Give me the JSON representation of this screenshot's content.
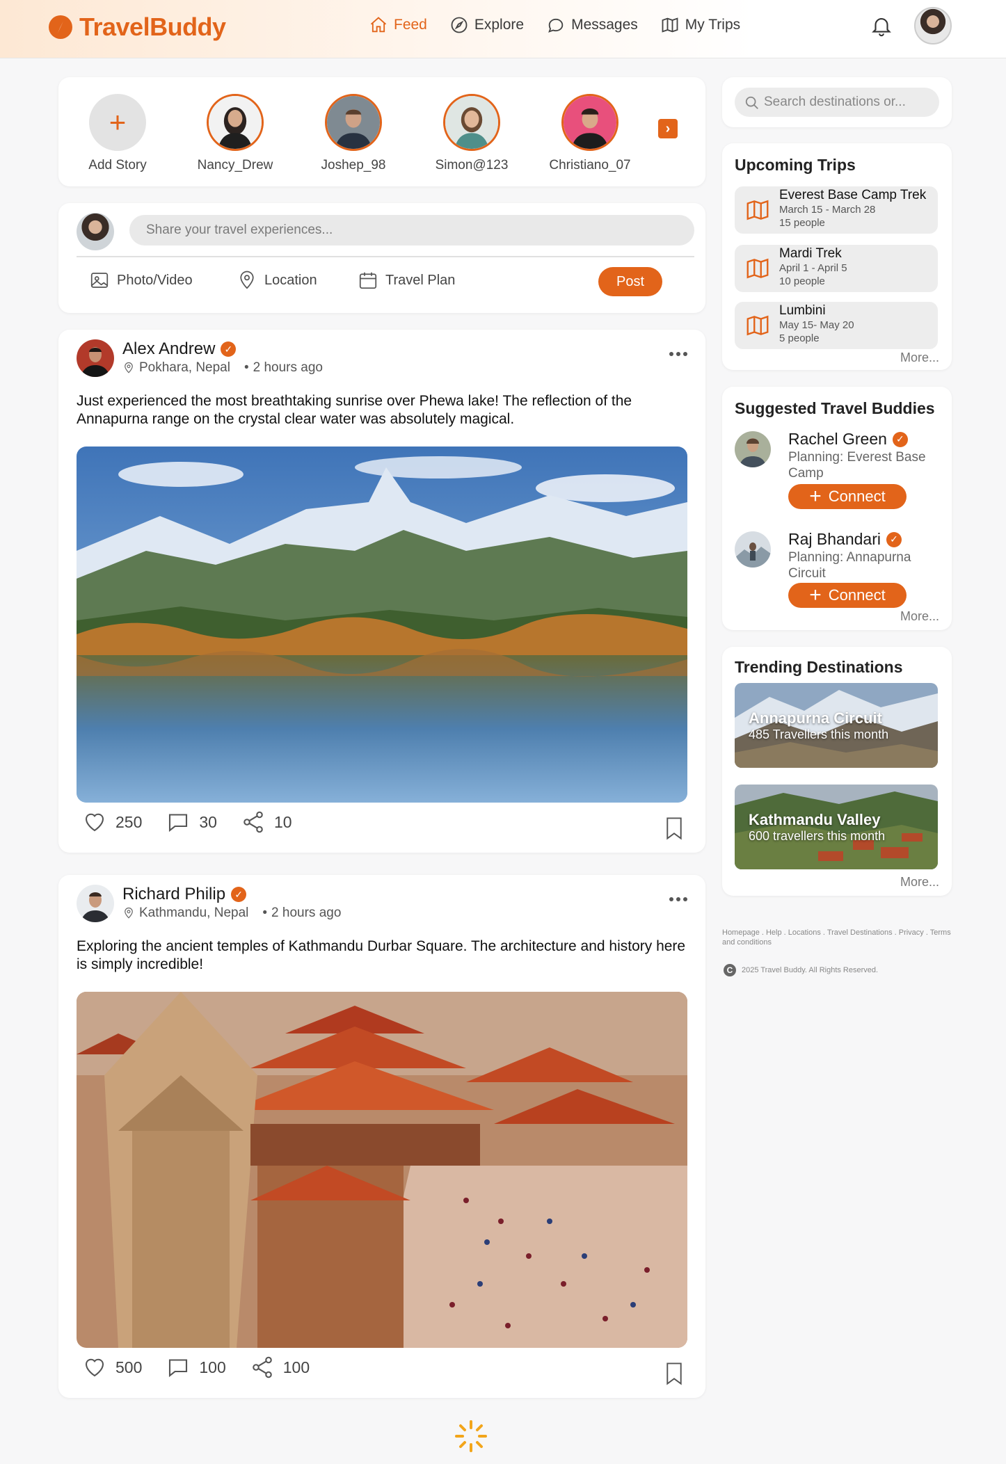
{
  "app": {
    "name": "TravelBuddy"
  },
  "nav": {
    "items": [
      {
        "label": "Feed",
        "icon": "home-icon",
        "active": true
      },
      {
        "label": "Explore",
        "icon": "compass-icon"
      },
      {
        "label": "Messages",
        "icon": "chat-icon"
      },
      {
        "label": "My Trips",
        "icon": "map-icon"
      }
    ]
  },
  "stories": {
    "add_label": "Add Story",
    "items": [
      {
        "name": "Nancy_Drew"
      },
      {
        "name": "Joshep_98"
      },
      {
        "name": "Simon@123"
      },
      {
        "name": "Christiano_07"
      }
    ]
  },
  "composer": {
    "placeholder": "Share your travel experiences...",
    "photo_label": "Photo/Video",
    "location_label": "Location",
    "plan_label": "Travel Plan",
    "post_label": "Post"
  },
  "posts": [
    {
      "author": "Alex Andrew",
      "location": "Pokhara, Nepal",
      "time": "2 hours ago",
      "text": "Just experienced the most breathtaking sunrise over Phewa lake! The reflection of the Annapurna range on the crystal clear water was absolutely magical.",
      "likes": "250",
      "comments": "30",
      "shares": "10"
    },
    {
      "author": "Richard Philip",
      "location": "Kathmandu, Nepal",
      "time": "2 hours ago",
      "text": "Exploring the ancient temples of Kathmandu Durbar Square. The architecture and history here is simply incredible!",
      "likes": "500",
      "comments": "100",
      "shares": "100"
    }
  ],
  "sidebar": {
    "search_placeholder": "Search destinations or...",
    "trips": {
      "title": "Upcoming Trips",
      "items": [
        {
          "name": "Everest Base Camp Trek",
          "dates": "March 15 - March 28",
          "people": "15 people"
        },
        {
          "name": "Mardi Trek",
          "dates": "April 1 - April 5",
          "people": "10 people"
        },
        {
          "name": "Lumbini",
          "dates": "May 15- May 20",
          "people": "5 people"
        }
      ],
      "more": "More..."
    },
    "buddies": {
      "title": "Suggested Travel Buddies",
      "items": [
        {
          "name": "Rachel Green",
          "plan": "Planning: Everest Base Camp",
          "button": "Connect"
        },
        {
          "name": "Raj Bhandari",
          "plan": "Planning: Annapurna Circuit",
          "button": "Connect"
        }
      ],
      "more": "More..."
    },
    "trending": {
      "title": "Trending Destinations",
      "items": [
        {
          "name": "Annapurna Circuit",
          "sub": "485 Travellers this month"
        },
        {
          "name": "Kathmandu Valley",
          "sub": "600 travellers this month"
        }
      ],
      "more": "More..."
    }
  },
  "footer": {
    "links": "Homepage . Help . Locations . Travel Destinations . Privacy . Terms and conditions",
    "copyright": "2025 Travel Buddy. All Rights Reserved."
  },
  "colors": {
    "accent": "#e2641a",
    "background": "#f7f7f8"
  }
}
